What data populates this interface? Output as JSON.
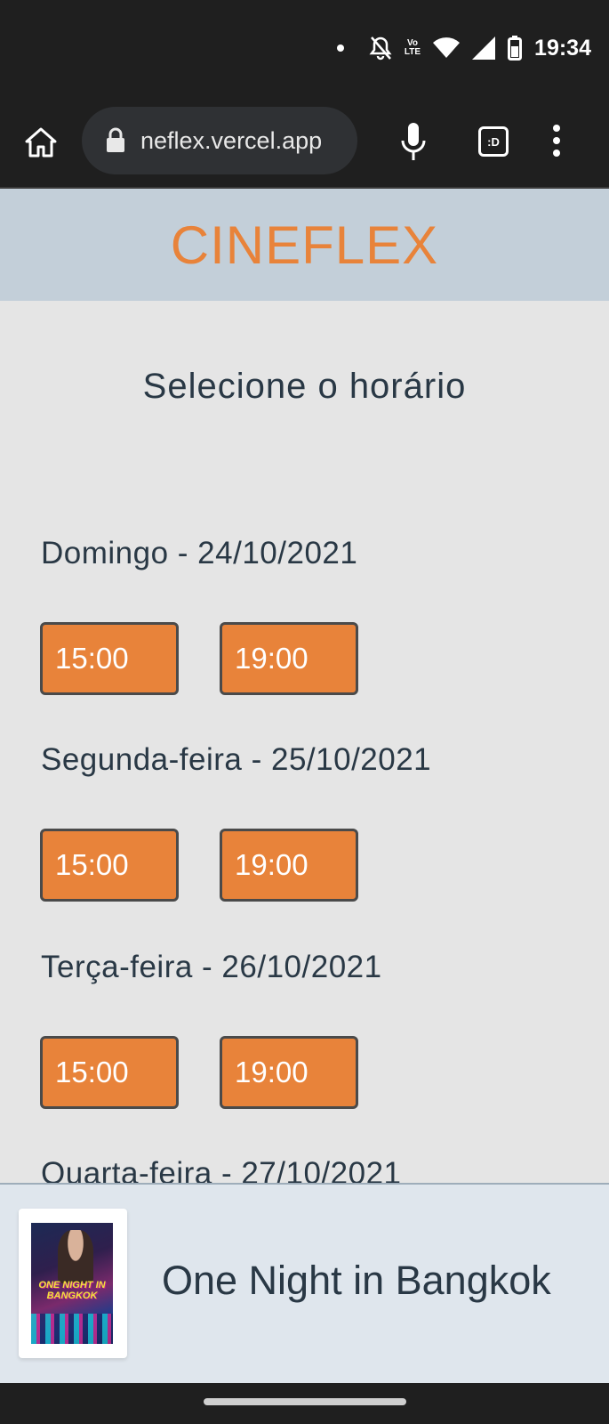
{
  "status_bar": {
    "time": "19:34",
    "network_badge_top": "Vo",
    "network_badge_bottom": "LTE",
    "icons": [
      "notification-dot-icon",
      "bell-off-icon",
      "volte-icon",
      "wifi-icon",
      "cell-signal-icon",
      "battery-icon"
    ]
  },
  "browser": {
    "url": "neflex.vercel.app",
    "tabs_label": ":D",
    "icons": [
      "home-icon",
      "lock-icon",
      "microphone-icon",
      "tabs-icon",
      "more-vert-icon"
    ]
  },
  "header": {
    "logo": "CINEFLEX",
    "logo_color": "#e8833a",
    "background": "#c3cfd9"
  },
  "page": {
    "title": "Selecione o horário"
  },
  "days": [
    {
      "label": "Domingo - 24/10/2021",
      "times": [
        "15:00",
        "19:00"
      ]
    },
    {
      "label": "Segunda-feira - 25/10/2021",
      "times": [
        "15:00",
        "19:00"
      ]
    },
    {
      "label": "Terça-feira - 26/10/2021",
      "times": [
        "15:00",
        "19:00"
      ]
    },
    {
      "label": "Quarta-feira - 27/10/2021"
    }
  ],
  "footer": {
    "movie_title": "One Night in Bangkok",
    "poster_text": "ONE NIGHT IN BANGKOK"
  },
  "colors": {
    "accent": "#e8833a",
    "text": "#293845",
    "page_bg": "#e5e5e5",
    "footer_bg": "#dfe6ed"
  }
}
